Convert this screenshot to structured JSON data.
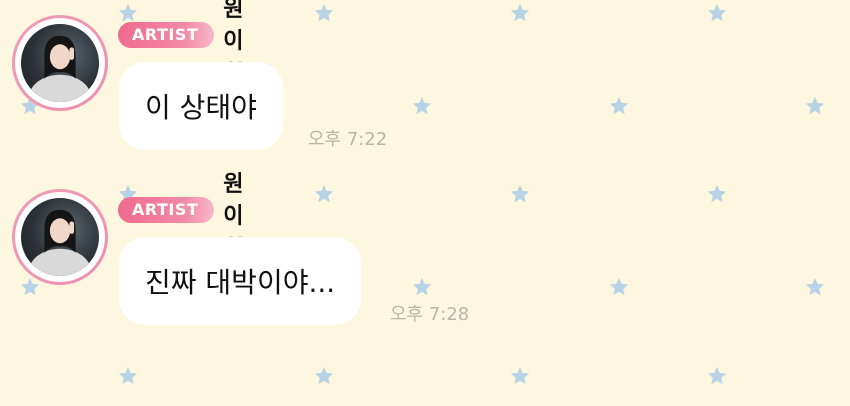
{
  "theme": {
    "background": "#fdf7df",
    "star_color": "#b9d3e6",
    "badge_color": "#ef6a8e",
    "avatar_ring_color": "#f29bb6"
  },
  "messages": [
    {
      "badge": "ARTIST",
      "sender": "원이ꝏ",
      "text": "이 상태야",
      "time": "오후 7:22"
    },
    {
      "badge": "ARTIST",
      "sender": "원이ꝏ",
      "text": "진짜 대박이야...",
      "time": "오후 7:28"
    }
  ],
  "background_icon": "star-icon"
}
